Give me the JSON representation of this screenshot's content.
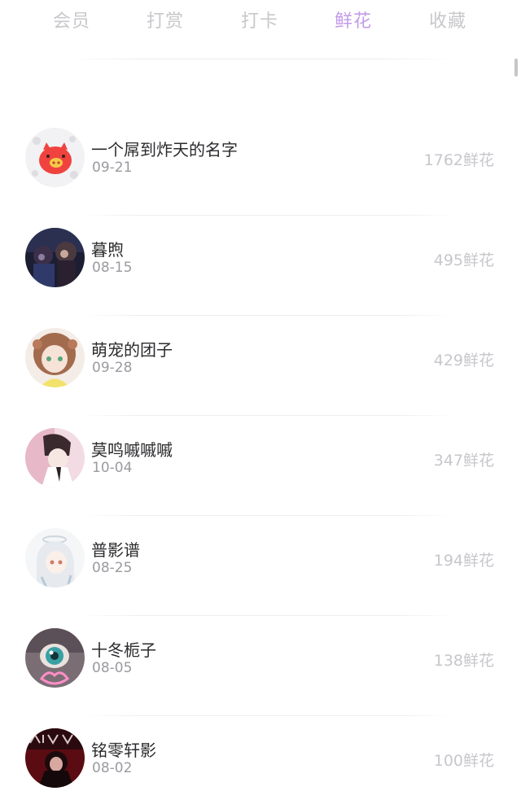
{
  "tabs": [
    {
      "label": "会员",
      "active": false
    },
    {
      "label": "打赏",
      "active": false
    },
    {
      "label": "打卡",
      "active": false
    },
    {
      "label": "鲜花",
      "active": true
    },
    {
      "label": "收藏",
      "active": false
    }
  ],
  "colors": {
    "active_tab": "#c39be8",
    "inactive_tab": "#c8c8cc",
    "name_text": "#2b2b2e",
    "date_text": "#9a9aa0",
    "amount_text": "#c7c7cc"
  },
  "list": {
    "items": [
      {
        "name": "一个屌到炸天的名字",
        "date": "09-21",
        "amount": "1762鲜花",
        "avatar_icon": "pig-avatar-icon"
      },
      {
        "name": "暮煦",
        "date": "08-15",
        "amount": "495鲜花",
        "avatar_icon": "dark-anime-avatar-icon"
      },
      {
        "name": "萌宠的团子",
        "date": "09-28",
        "amount": "429鲜花",
        "avatar_icon": "brown-hair-girl-avatar-icon"
      },
      {
        "name": "莫鸣嘁嘁嘁",
        "date": "10-04",
        "amount": "347鲜花",
        "avatar_icon": "pink-anime-avatar-icon"
      },
      {
        "name": "普影谱",
        "date": "08-25",
        "amount": "194鲜花",
        "avatar_icon": "white-hair-avatar-icon"
      },
      {
        "name": "十冬栀子",
        "date": "08-05",
        "amount": "138鲜花",
        "avatar_icon": "eye-avatar-icon"
      },
      {
        "name": "铭零轩影",
        "date": "08-02",
        "amount": "100鲜花",
        "avatar_icon": "red-dark-avatar-icon"
      }
    ]
  }
}
